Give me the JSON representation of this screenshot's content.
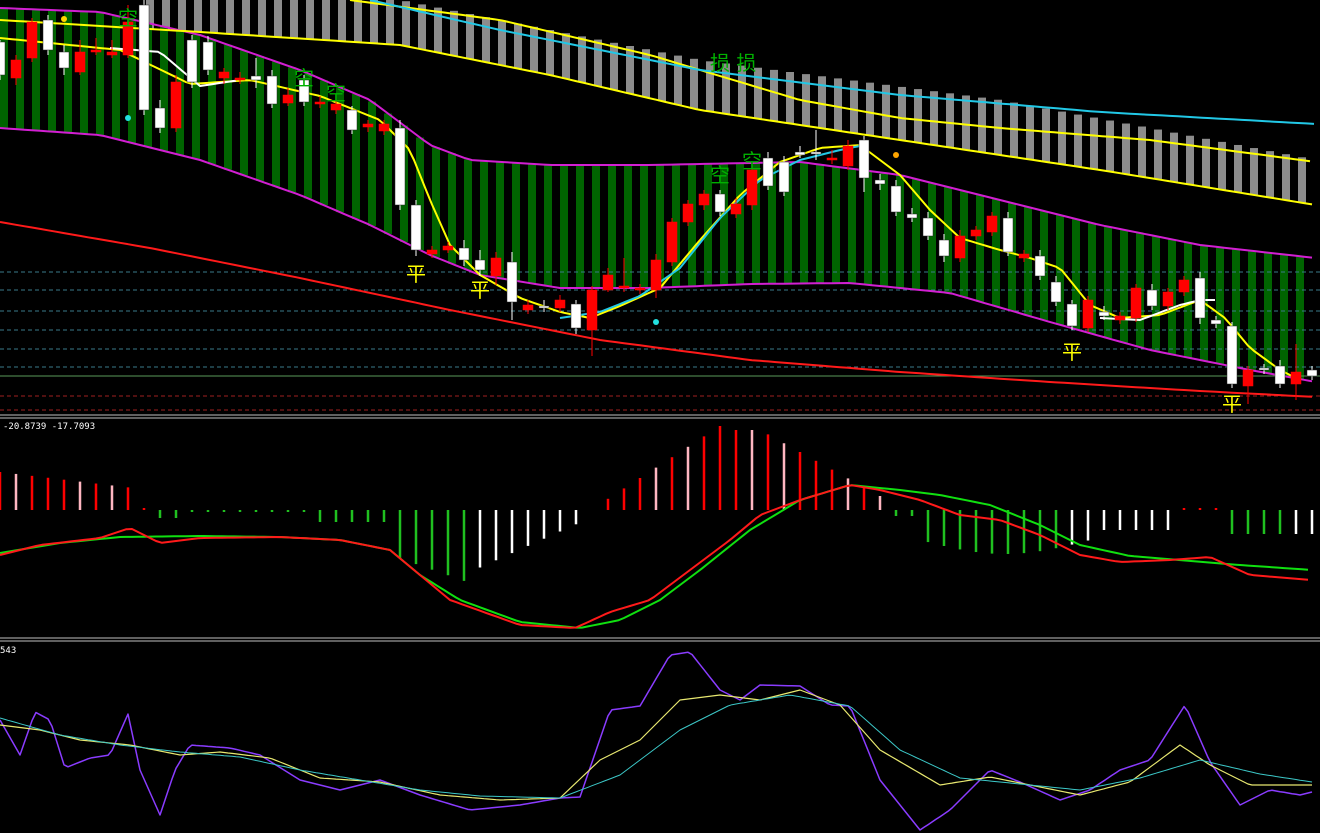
{
  "chart": {
    "macd_label": "-20.8739 -17.7093",
    "osc_label": "543",
    "colors": {
      "bull": "#ffffff",
      "bear": "#ff0000",
      "cloud_green": "#006400",
      "cloud_gray": "#8c8c8c",
      "band": "#d21fd2",
      "slow_line": "#ff1a1a",
      "ma_yellow": "#ffff00",
      "ma_cyan": "#22c8e6",
      "signal_green": "#10e010",
      "hist_pink": "#ffb6c1",
      "hist_green": "#20c020",
      "stoch_purple": "#8a3cff",
      "stoch_yellow": "#e8e870",
      "stoch_teal": "#3cc8c8"
    }
  },
  "signals": [
    {
      "text": "空",
      "color": "#00b000"
    },
    {
      "text": "空",
      "color": "#00b000"
    },
    {
      "text": "空",
      "color": "#00b000"
    },
    {
      "text": "空",
      "color": "#00b000"
    },
    {
      "text": "空",
      "color": "#00b000"
    },
    {
      "text": "损 损",
      "color": "#00b000"
    },
    {
      "text": "平",
      "color": "#ffff00"
    },
    {
      "text": "平",
      "color": "#ffff00"
    },
    {
      "text": "平",
      "color": "#ffff00"
    },
    {
      "text": "平",
      "color": "#ffff00"
    }
  ]
}
